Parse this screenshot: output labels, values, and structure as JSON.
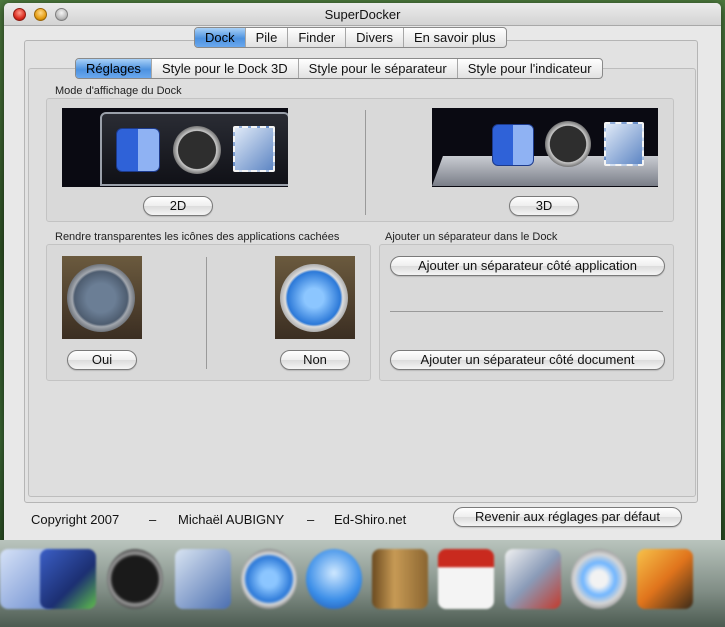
{
  "window": {
    "title": "SuperDocker"
  },
  "main_tabs": [
    {
      "label": "Dock",
      "selected": true
    },
    {
      "label": "Pile",
      "selected": false
    },
    {
      "label": "Finder",
      "selected": false
    },
    {
      "label": "Divers",
      "selected": false
    },
    {
      "label": "En savoir plus",
      "selected": false
    }
  ],
  "sub_tabs": [
    {
      "label": "Réglages",
      "selected": true
    },
    {
      "label": "Style pour le Dock 3D",
      "selected": false
    },
    {
      "label": "Style pour le séparateur",
      "selected": false
    },
    {
      "label": "Style pour l'indicateur",
      "selected": false
    }
  ],
  "display_mode": {
    "label": "Mode d'affichage du Dock",
    "button_2d": "2D",
    "button_3d": "3D"
  },
  "transparency": {
    "label": "Rendre transparentes les icônes des applications cachées",
    "button_yes": "Oui",
    "button_no": "Non"
  },
  "separator": {
    "label": "Ajouter un séparateur dans le Dock",
    "button_app": "Ajouter un séparateur côté application",
    "button_doc": "Ajouter un séparateur côté document"
  },
  "footer": {
    "copyright": "Copyright 2007",
    "dash1": "–",
    "author": "Michaël AUBIGNY",
    "dash2": "–",
    "site": "Ed-Shiro.net",
    "reset_button": "Revenir aux réglages par défaut"
  },
  "colors": {
    "selected_segment": "#4d92e0",
    "window_bg": "#e8e8e8"
  },
  "icons": {
    "finder": "finder-icon",
    "dashboard": "dashboard-clock-icon",
    "mail": "mail-stamp-icon",
    "safari": "safari-compass-icon"
  }
}
